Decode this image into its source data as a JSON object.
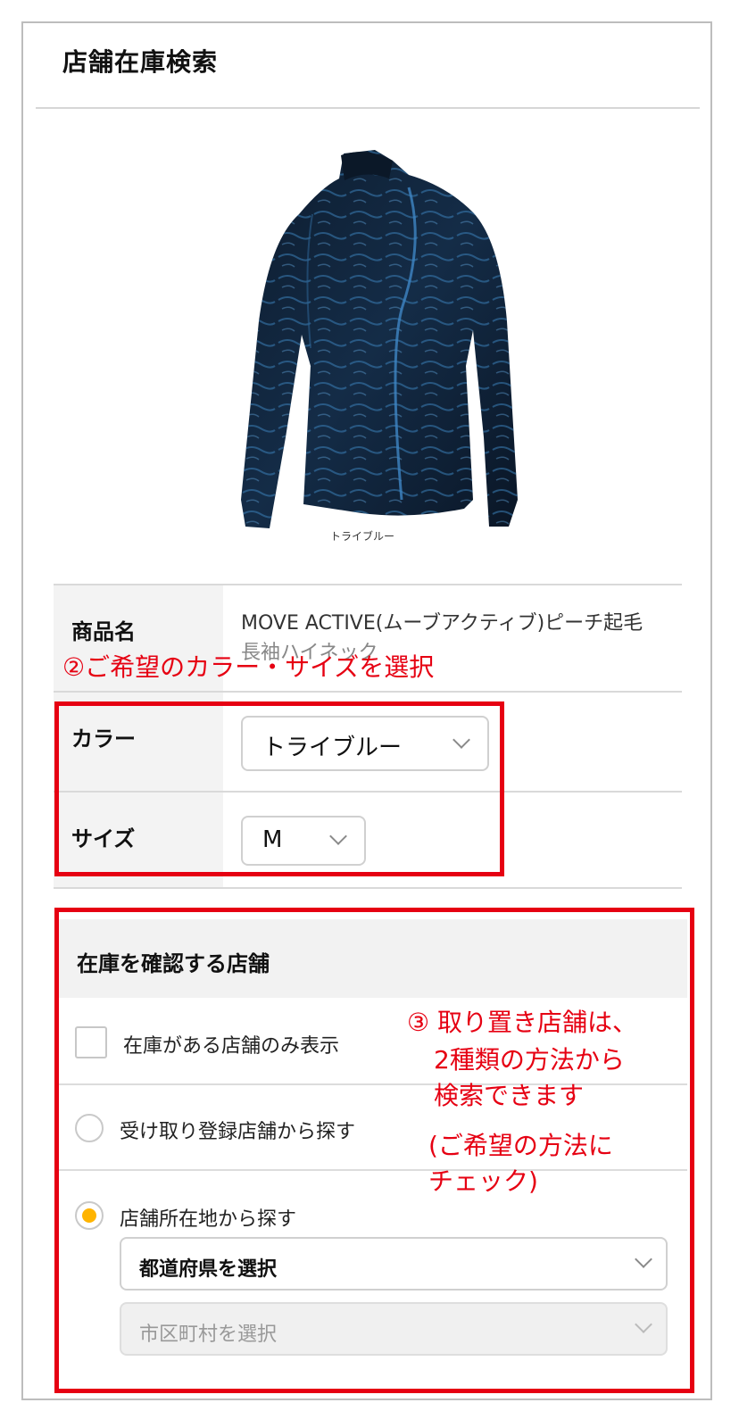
{
  "page": {
    "title": "店舗在庫検索"
  },
  "product": {
    "color_caption": "トライブルー",
    "name_label": "商品名",
    "name_value_line1": "MOVE ACTIVE(ムーブアクティブ)ピーチ起毛",
    "name_value_line2": "長袖ハイネック"
  },
  "options": {
    "color_label": "カラー",
    "color_selected": "トライブルー",
    "size_label": "サイズ",
    "size_selected": "M"
  },
  "annotations": {
    "step2": "②ご希望のカラー・サイズを選択",
    "step3_line1": "③ 取り置き店舗は、",
    "step3_line2": "2種類の方法から",
    "step3_line3": "検索できます",
    "step3_line4": "(ご希望の方法に",
    "step3_line5": "チェック)",
    "color": "#e60012"
  },
  "store_section": {
    "heading": "在庫を確認する店舗",
    "in_stock_only_label": "在庫がある店舗のみ表示",
    "radio_registered_label": "受け取り登録店舗から探す",
    "radio_location_label": "店舗所在地から探す",
    "prefecture_placeholder": "都道府県を選択",
    "city_placeholder": "市区町村を選択",
    "selected_radio": "location",
    "radio_accent": "#ffb400"
  }
}
